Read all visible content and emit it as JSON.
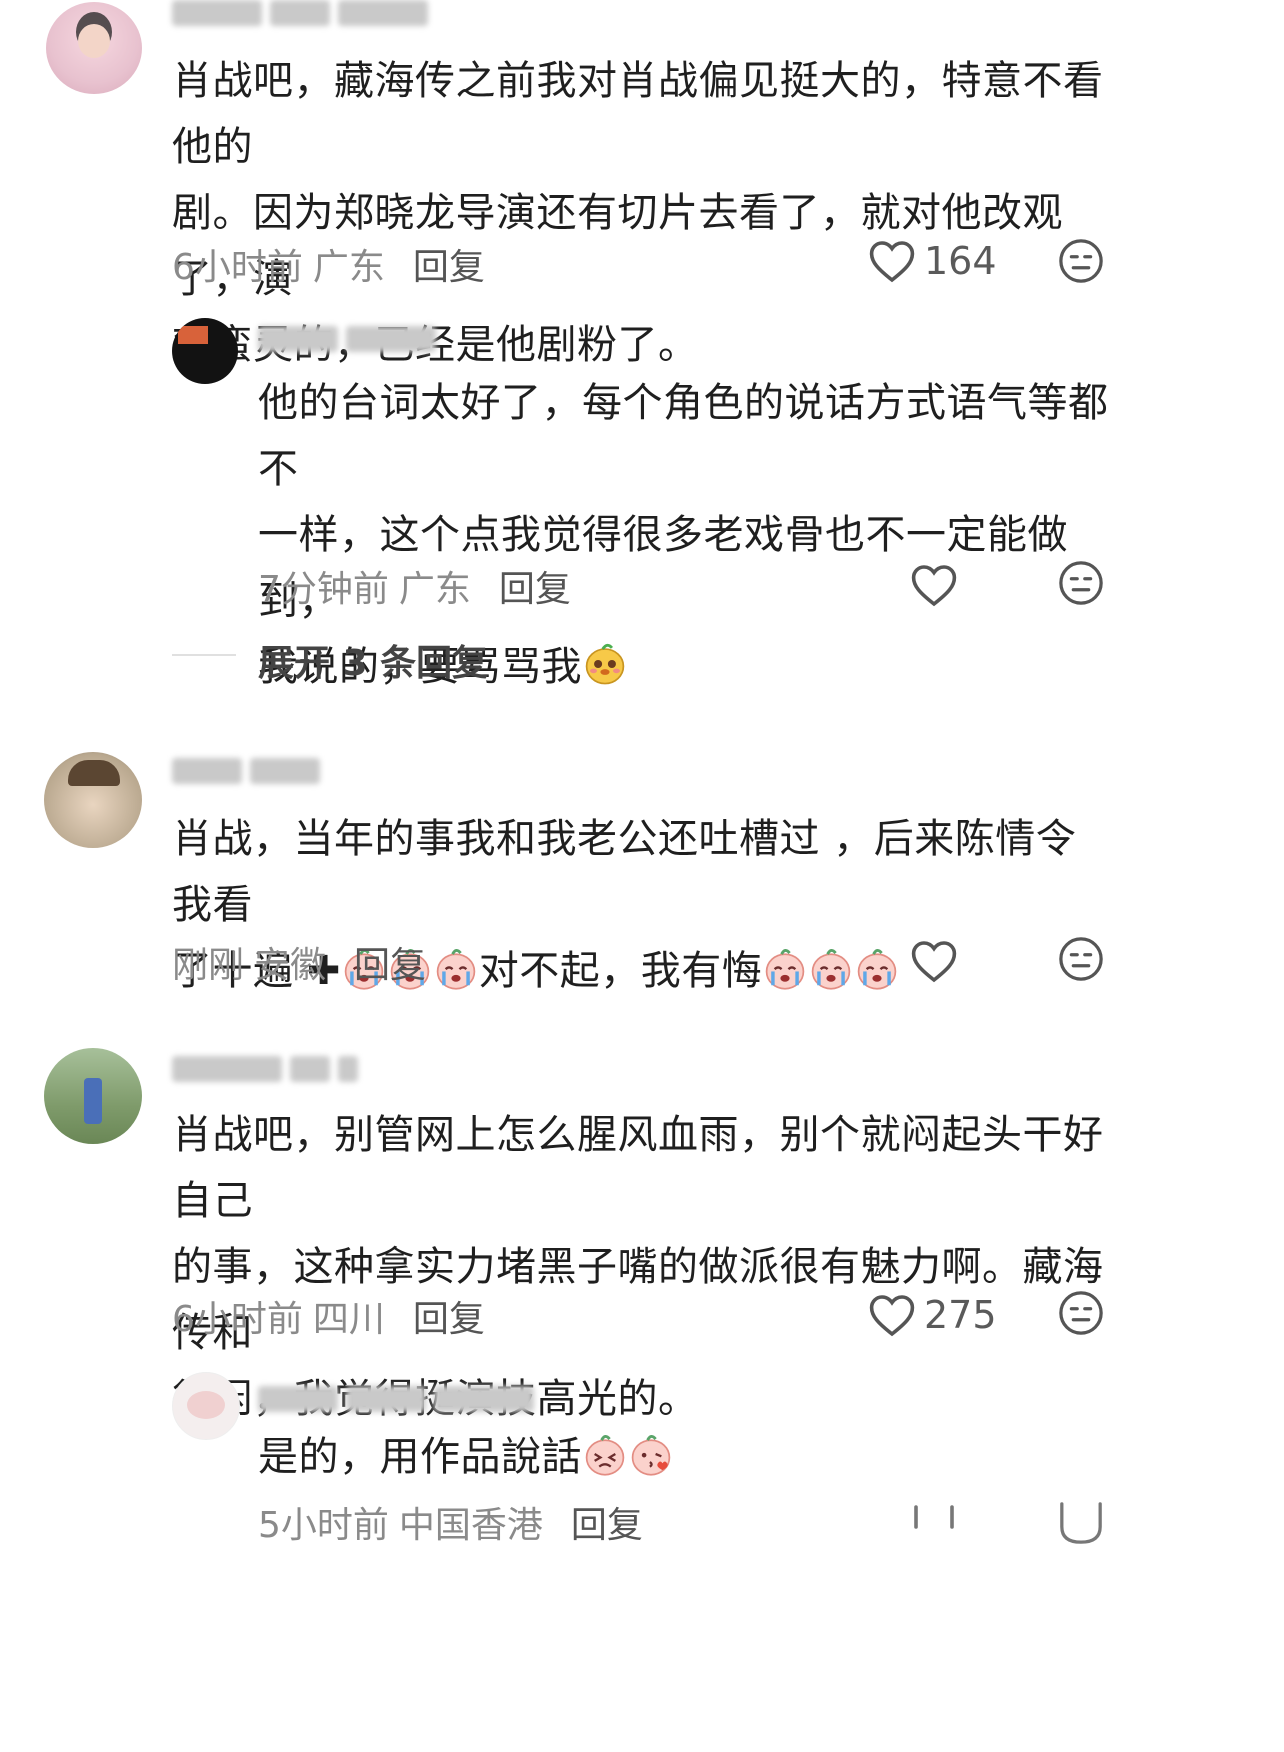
{
  "comments": [
    {
      "text": "肖战吧，藏海传之前我对肖战偏见挺大的，特意不看他的剧。因为郑晓龙导演还有切片去看了，就对他改观了，演戏蛮灵的，已经是他剧粉了。",
      "line1": "肖战吧，藏海传之前我对肖战偏见挺大的，特意不看他的",
      "line2": "剧。因为郑晓龙导演还有切片去看了，就对他改观了，演",
      "line3": "戏蛮灵的，已经是他剧粉了。",
      "time": "6小时前",
      "location": "广东",
      "reply_label": "回复",
      "likes": "164"
    },
    {
      "line1": "他的台词太好了，每个角色的说话方式语气等都不",
      "line2": "一样，这个点我觉得很多老戏骨也不一定能做到，",
      "line3": "我说的，要骂骂我",
      "time": "7分钟前",
      "location": "广东",
      "reply_label": "回复",
      "expand_label": "展开 3 条回复"
    },
    {
      "line1": "肖战，当年的事我和我老公还吐槽过 ，后来陈情令我看",
      "line2_a": "了十遍",
      "line2_b": "对不起，我有悔",
      "time": "刚刚",
      "location": "安徽",
      "reply_label": "回复"
    },
    {
      "line1": "肖战吧，别管网上怎么腥风血雨，别个就闷起头干好自己",
      "line2": "的事，这种拿实力堵黑子嘴的做派很有魅力啊。藏海传和",
      "line3": "得闲，我觉得挺演技高光的。",
      "time": "6小时前",
      "location": "四川",
      "reply_label": "回复",
      "likes": "275"
    },
    {
      "line1": "是的，用作品說話",
      "time": "5小时前",
      "location": "中国香港",
      "reply_label": "回复"
    }
  ],
  "icons": {
    "like": "heart-outline-icon",
    "dislike": "neutral-face-icon",
    "plus": "plus-icon",
    "emoji_cry": "crying-peach-emoji",
    "emoji_dog": "dog-face-emoji"
  },
  "colors": {
    "text": "#1f1f1f",
    "meta": "#8a8a8a",
    "icon": "#555555"
  }
}
